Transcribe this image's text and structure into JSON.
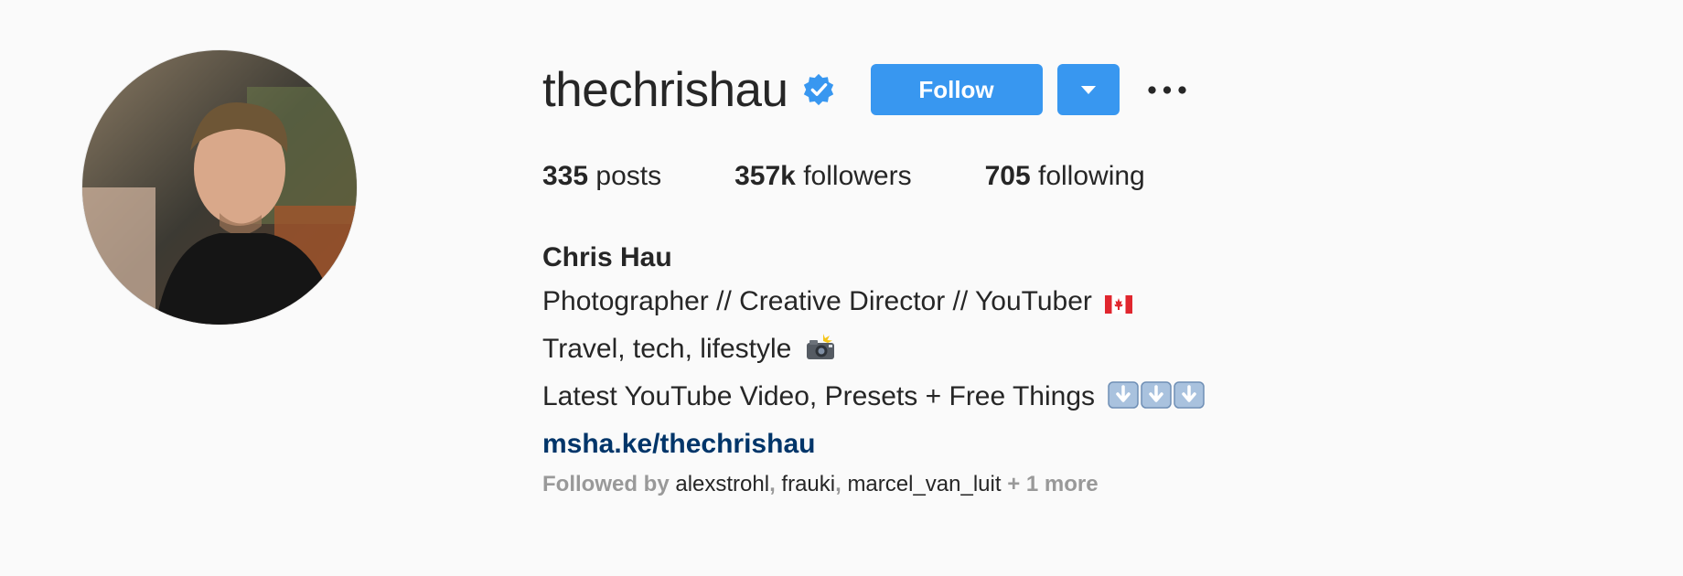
{
  "profile": {
    "username": "thechrishau",
    "verified": true,
    "follow_label": "Follow",
    "stats": {
      "posts_count": "335",
      "posts_label": "posts",
      "followers_count": "357k",
      "followers_label": "followers",
      "following_count": "705",
      "following_label": "following"
    },
    "bio": {
      "name": "Chris Hau",
      "line1": "Photographer // Creative Director // YouTuber",
      "line1_emoji": "canadian-flag",
      "line2": "Travel, tech, lifestyle",
      "line2_emoji": "camera-with-flash",
      "line3": "Latest YouTube Video, Presets + Free Things",
      "line3_emoji": "down-arrow-x3",
      "link": "msha.ke/thechrishau"
    },
    "followed_by": {
      "prefix": "Followed by",
      "users": [
        "alexstrohl",
        "frauki",
        "marcel_van_luit"
      ],
      "separator": ",",
      "more": "+ 1 more"
    }
  },
  "colors": {
    "accent": "#3897f0",
    "link": "#003569",
    "text": "#262626",
    "muted": "#999999",
    "background": "#fafafa"
  },
  "icons": {
    "verified": "verified-badge-icon",
    "dropdown": "triangle-down-icon",
    "more": "more-options-icon"
  }
}
